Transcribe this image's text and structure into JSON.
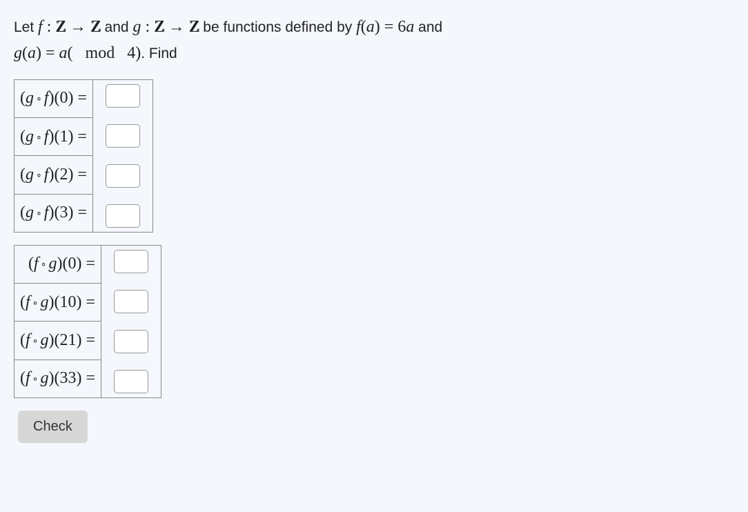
{
  "question": {
    "prefix": "Let ",
    "f_colon": " : ",
    "arrow": " → ",
    "and_text": " and ",
    "g_colon": " : ",
    "be_text": " be functions defined by ",
    "f_def_lhs_f": "f",
    "f_def_lhs_paren_open": "(",
    "f_def_lhs_a": "a",
    "f_def_lhs_paren_close": ")",
    "eq": " = ",
    "f_def_rhs_6": "6",
    "f_def_rhs_a": "a",
    "and2": " and",
    "g_def_lhs_g": "g",
    "g_def_lhs_paren_open": "(",
    "g_def_lhs_a": "a",
    "g_def_lhs_paren_close": ")",
    "g_def_rhs_a": "a",
    "g_def_rhs_open": "(",
    "g_def_mod": "mod",
    "g_def_4": " 4",
    "g_def_rhs_close": ")",
    "find": ". Find"
  },
  "tables": {
    "gf": [
      {
        "open": "(",
        "g": "g",
        "f": "f",
        "close": ")",
        "arg_open": "(",
        "arg": "0",
        "arg_close": ")",
        "eq": " ="
      },
      {
        "open": "(",
        "g": "g",
        "f": "f",
        "close": ")",
        "arg_open": "(",
        "arg": "1",
        "arg_close": ")",
        "eq": " ="
      },
      {
        "open": "(",
        "g": "g",
        "f": "f",
        "close": ")",
        "arg_open": "(",
        "arg": "2",
        "arg_close": ")",
        "eq": " ="
      },
      {
        "open": "(",
        "g": "g",
        "f": "f",
        "close": ")",
        "arg_open": "(",
        "arg": "3",
        "arg_close": ")",
        "eq": " ="
      }
    ],
    "fg": [
      {
        "open": "(",
        "f": "f",
        "g": "g",
        "close": ")",
        "arg_open": "(",
        "arg": "0",
        "arg_close": ")",
        "eq": " ="
      },
      {
        "open": "(",
        "f": "f",
        "g": "g",
        "close": ")",
        "arg_open": "(",
        "arg": "10",
        "arg_close": ")",
        "eq": " ="
      },
      {
        "open": "(",
        "f": "f",
        "g": "g",
        "close": ")",
        "arg_open": "(",
        "arg": "21",
        "arg_close": ")",
        "eq": " ="
      },
      {
        "open": "(",
        "f": "f",
        "g": "g",
        "close": ")",
        "arg_open": "(",
        "arg": "33",
        "arg_close": ")",
        "eq": " ="
      }
    ]
  },
  "button": {
    "check": "Check"
  }
}
